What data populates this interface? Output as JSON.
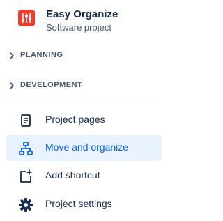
{
  "project": {
    "name": "Easy Organize",
    "type": "Software project",
    "logo_icon": "project-logo-icon",
    "logo_color": "#ee3d2f"
  },
  "sections": [
    {
      "label": "PLANNING",
      "icon": "chevron-right-icon",
      "expanded": false
    },
    {
      "label": "DEVELOPMENT",
      "icon": "chevron-right-icon",
      "expanded": false
    }
  ],
  "nav": [
    {
      "label": "Project pages",
      "icon": "page-icon",
      "selected": false
    },
    {
      "label": "Move and organize",
      "icon": "hierarchy-icon",
      "selected": true
    },
    {
      "label": "Add shortcut",
      "icon": "add-shortcut-icon",
      "selected": false
    },
    {
      "label": "Project settings",
      "icon": "gear-icon",
      "selected": false
    }
  ],
  "colors": {
    "accent": "#0c66e4",
    "selected_bg": "#e9f2ff",
    "text": "#172b4d",
    "muted": "#44546f"
  }
}
